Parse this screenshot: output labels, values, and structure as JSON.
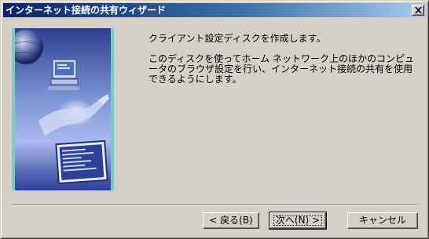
{
  "window": {
    "title": "インターネット接続の共有ウィザード",
    "close_glyph": "✕"
  },
  "content": {
    "heading": "クライアント設定ディスクを作成します。",
    "paragraph": "このディスクを使ってホーム ネットワーク上のほかのコンピュータのブラウザ設定を行い、インターネット接続の共有を使用できるようにします。"
  },
  "buttons": {
    "back": "< 戻る(B)",
    "next": "次へ(N) >",
    "cancel": "キャンセル"
  },
  "colors": {
    "titlebar_start": "#0a246a",
    "titlebar_end": "#a6caf0",
    "panel": "#7dc9c4"
  }
}
